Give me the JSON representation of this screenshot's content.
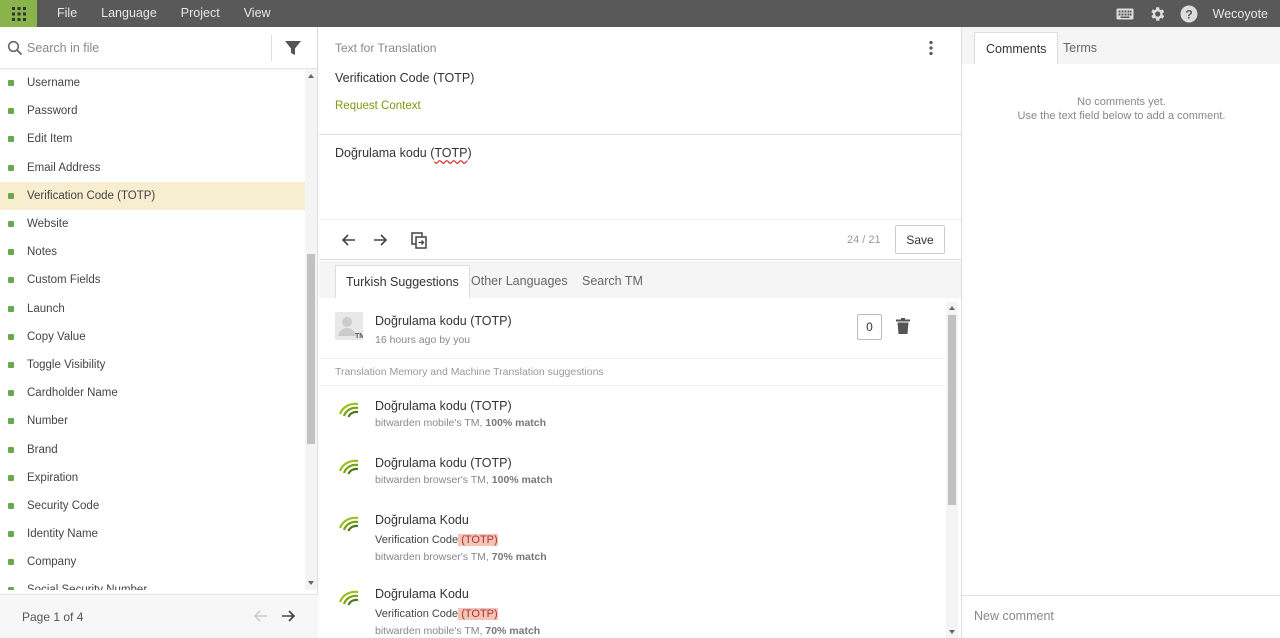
{
  "topbar": {
    "menu": [
      "File",
      "Language",
      "Project",
      "View"
    ],
    "user": "Wecoyote"
  },
  "sidebar": {
    "search_placeholder": "Search in file",
    "items": [
      {
        "label": "Username"
      },
      {
        "label": "Password"
      },
      {
        "label": "Edit Item"
      },
      {
        "label": "Email Address"
      },
      {
        "label": "Verification Code (TOTP)",
        "active": true
      },
      {
        "label": "Website"
      },
      {
        "label": "Notes"
      },
      {
        "label": "Custom Fields"
      },
      {
        "label": "Launch"
      },
      {
        "label": "Copy Value"
      },
      {
        "label": "Toggle Visibility"
      },
      {
        "label": "Cardholder Name"
      },
      {
        "label": "Number"
      },
      {
        "label": "Brand"
      },
      {
        "label": "Expiration"
      },
      {
        "label": "Security Code"
      },
      {
        "label": "Identity Name"
      },
      {
        "label": "Company"
      },
      {
        "label": "Social Security Number"
      }
    ],
    "status_color": "#6aa84f",
    "page_label": "Page 1 of 4"
  },
  "editor": {
    "source_header": "Text for Translation",
    "source_text": "Verification Code (TOTP)",
    "request_context": "Request Context",
    "target_prefix": "Doğrulama kodu (",
    "target_flagged": "TOTP",
    "target_suffix": ")",
    "char_count": "24 / 21",
    "save_label": "Save"
  },
  "suggestions": {
    "tabs": [
      "Turkish Suggestions",
      "Other Languages",
      "Search TM"
    ],
    "own": {
      "text": "Doğrulama kodu (TOTP)",
      "meta": "16 hours ago by you",
      "votes": "0"
    },
    "tm_header": "Translation Memory and Machine Translation suggestions",
    "tm_items": [
      {
        "text": "Doğrulama kodu (TOTP)",
        "source": "bitwarden mobile's TM, ",
        "match": "100% match"
      },
      {
        "text": "Doğrulama kodu (TOTP)",
        "source": "bitwarden browser's TM, ",
        "match": "100% match"
      },
      {
        "text": "Doğrulama Kodu",
        "diff_pre": "Verification Code",
        "diff_del": " (TOTP)",
        "source": "bitwarden browser's TM, ",
        "match": "70% match"
      },
      {
        "text": "Doğrulama Kodu",
        "diff_pre": "Verification Code",
        "diff_del": " (TOTP)",
        "source": "bitwarden mobile's TM, ",
        "match": "70% match"
      }
    ]
  },
  "comments": {
    "tabs": [
      "Comments",
      "Terms"
    ],
    "empty_line1": "No comments yet.",
    "empty_line2": "Use the text field below to add a comment.",
    "input_placeholder": "New comment"
  },
  "colors": {
    "topbar": "#595959",
    "apps_button": "#8ab34a",
    "active_row": "#f7eed0",
    "link_green": "#7a9a12"
  }
}
